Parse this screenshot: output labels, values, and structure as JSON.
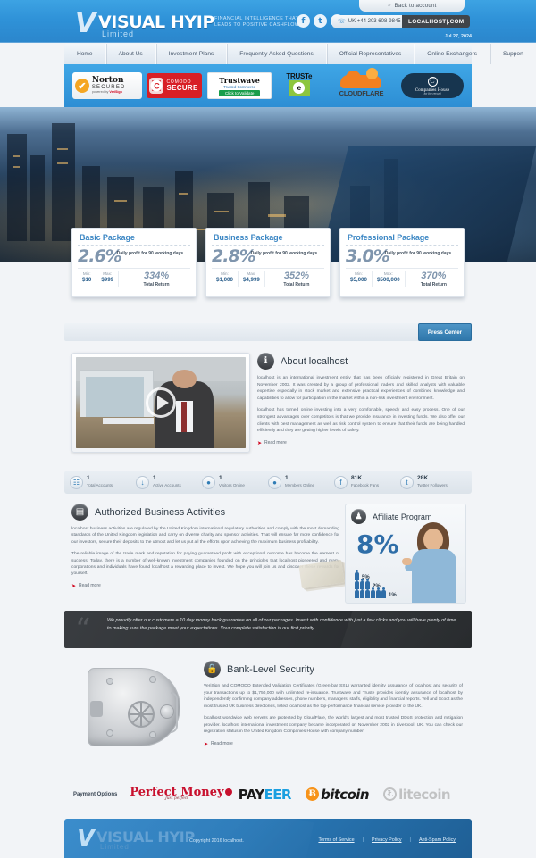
{
  "topbar": {
    "back_to_account": "Back to account",
    "user_icon": "user-icon",
    "logo_main": "VISUAL HYIP",
    "logo_sub": "Limited",
    "tagline": "FINANCIAL INTELLIGENCE THAT LEADS TO POSITIVE CASHFLOW",
    "socials": [
      {
        "name": "facebook-icon",
        "glyph": "f"
      },
      {
        "name": "twitter-icon",
        "glyph": "t"
      },
      {
        "name": "blogger-icon",
        "glyph": "B"
      }
    ],
    "phone": "UK +44 203 608-9845",
    "phone_icon": "phone-icon",
    "site": "LOCALHOST|.COM",
    "date": "Jul 27, 2024"
  },
  "nav": {
    "items": [
      "Home",
      "About Us",
      "Investment Plans",
      "Frequently Asked Questions",
      "Official Representatives",
      "Online Exchangers",
      "Support"
    ]
  },
  "badges": {
    "norton": {
      "title": "Norton",
      "sub": "SECURED",
      "powered": "powered by",
      "brand": "VeriSign",
      "check": "✔"
    },
    "comodo": {
      "letter": "C",
      "line1": "COMODO",
      "line2": "SECURE"
    },
    "trustwave": {
      "name": "Trustwave",
      "sub": "Trusted Commerce",
      "cta": "Click to Validate",
      "mark": "⚑"
    },
    "truste": {
      "name": "TRUSTe",
      "certified": "CERTIFIED",
      "glyph": "e"
    },
    "cloudflare": {
      "name": "CLOUDFLARE"
    },
    "companies_house": {
      "glyph": "C",
      "line1": "Companies House",
      "line2": "for the record"
    }
  },
  "packages": [
    {
      "title": "Basic Package",
      "rate": "2.6%",
      "rate_desc": "Daily profit for 90 working  days",
      "min_label": "Min:",
      "min_value": "$10",
      "max_label": "Max:",
      "max_value": "$999",
      "total": "334%",
      "total_label": "Total Return"
    },
    {
      "title": "Business Package",
      "rate": "2.8%",
      "rate_desc": "Daily profit for 90 working  days",
      "min_label": "Min:",
      "min_value": "$1,000",
      "max_label": "Max:",
      "max_value": "$4,999",
      "total": "352%",
      "total_label": "Total Return"
    },
    {
      "title": "Professional Package",
      "rate": "3.0%",
      "rate_desc": "Daily profit for 90 working  days",
      "min_label": "Min:",
      "min_value": "$5,000",
      "max_label": "Max:",
      "max_value": "$500,000",
      "total": "370%",
      "total_label": "Total Return"
    }
  ],
  "press": {
    "button": "Press Center"
  },
  "about": {
    "icon": "info-icon",
    "icon_glyph": "i",
    "title": "About localhost",
    "video_play_icon": "play-button-icon",
    "paragraph1": "localhost is an international investment entity that has been officially registered in Great Britain on November 2002. It was created by a group of professional traders and skilled analysts with valuable expertise especially in stock market and extensive practical experiences of combined knowledge and capabilities to allow for participation in the market within a non-risk investment environment.",
    "paragraph2": "localhost has turned online investing into a very comfortable, speedy and easy process. One of our strongest advantages over competitors is that we provide insurance in investing funds. We also offer our clients with best management as well as risk control system to ensure that their funds are being handled efficiently and they are getting higher levels of safety.",
    "read_more": "Read more"
  },
  "stats": [
    {
      "icon": "total-accounts-icon",
      "glyph": "☷",
      "value": "1",
      "label": "Total Accounts"
    },
    {
      "icon": "active-accounts-icon",
      "glyph": "↓",
      "value": "1",
      "label": "Active Accounts"
    },
    {
      "icon": "visitors-online-icon",
      "glyph": "●",
      "value": "1",
      "label": "Visitors Online"
    },
    {
      "icon": "members-online-icon",
      "glyph": "●",
      "value": "1",
      "label": "Members Online"
    },
    {
      "icon": "facebook-icon",
      "glyph": "f",
      "value": "81K",
      "label": "Facebook Fans"
    },
    {
      "icon": "twitter-icon",
      "glyph": "t",
      "value": "28K",
      "label": "Twitter Followers"
    }
  ],
  "activities": {
    "icon": "briefcase-icon",
    "icon_glyph": "▤",
    "title": "Authorized Business Activities",
    "paragraph1": "localhost business activities are regulated by the United Kingdom international regulatory authorities and comply with the most demanding standards of the United Kingdom legislation and carry on diverse charity and sponsor activities. That will ensure far more confidence for our investors, secure their deposits to the utmost and let us put all the efforts upon achieving the maximum business profitability.",
    "paragraph2": "The reliable image of the trade mark and reputation for paying guaranteed profit with exceptional outcome has become the earnest of success. Today, there is a number of well-known investment companies founded on the principles that localhost pioneered and many corporations and individuals have found localhost a rewarding place to invest. We hope you will join us and discover these rewards for yourself.",
    "read_more": "Read more"
  },
  "affiliate": {
    "icon": "affiliate-people-icon",
    "icon_glyph": "♟",
    "title": "Affiliate Program",
    "headline": "8%",
    "tiers": [
      {
        "percent": "5%",
        "people": 1
      },
      {
        "percent": "2%",
        "people": 3
      },
      {
        "percent": "1%",
        "people": 6
      }
    ]
  },
  "quote": {
    "mark": "“",
    "text": "We proudly offer our customers a 10 day money back guarantee on all of our packages. Invest with confidence with just a few clicks and you will have plenty of time to making sure the package meet your expectations. Your complete satisfaction is our first priority."
  },
  "security": {
    "icon": "lock-icon",
    "icon_glyph": "🔒",
    "title": "Bank-Level Security",
    "vault_image": "bank-vault-door-image",
    "paragraph1": "VeriSign and COMODO Extended Validation Certificates (Green-bar SSL) warranted identity assurance of localhost and security of your transactions up to $1,750,000 with unlimited re-issuance. Trustwave and Truste provides identity assurance of localhost by independently confirming company addresses, phone numbers, managers, staffs, eligibility and financial reports. Yell and Scoot as the most trusted UK business directories, listed localhost as the top-performance financial service provider of the UK.",
    "paragraph2": "localhost worldwide web servers are protected by CloudFlare, the world's largest and most trusted DDoS protection and mitigation provider. localhost international investment company became incorporated on November 2002 in Liverpool, UK. You can check our registration status in the United Kingdom Companies House with company number.",
    "read_more": "Read more"
  },
  "payments": {
    "label": "Payment Options",
    "methods": [
      {
        "name": "perfect-money-logo",
        "line1": "Perfect Money",
        "line2": "Just perfect"
      },
      {
        "name": "payeer-logo",
        "part1": "PAY",
        "part2": "EER"
      },
      {
        "name": "bitcoin-logo",
        "symbol": "Ƀ",
        "text": "bitcoin"
      },
      {
        "name": "litecoin-logo",
        "symbol": "Ł",
        "text": "litecoin"
      }
    ]
  },
  "footer": {
    "logo_main": "VISUAL HYIP",
    "logo_sub": "Limited",
    "copyright": "Copyright 2016 localhost.",
    "links": [
      "Terms of Service",
      "Privacy Policy",
      "Anti-Spam Policy"
    ],
    "separator": "|"
  }
}
